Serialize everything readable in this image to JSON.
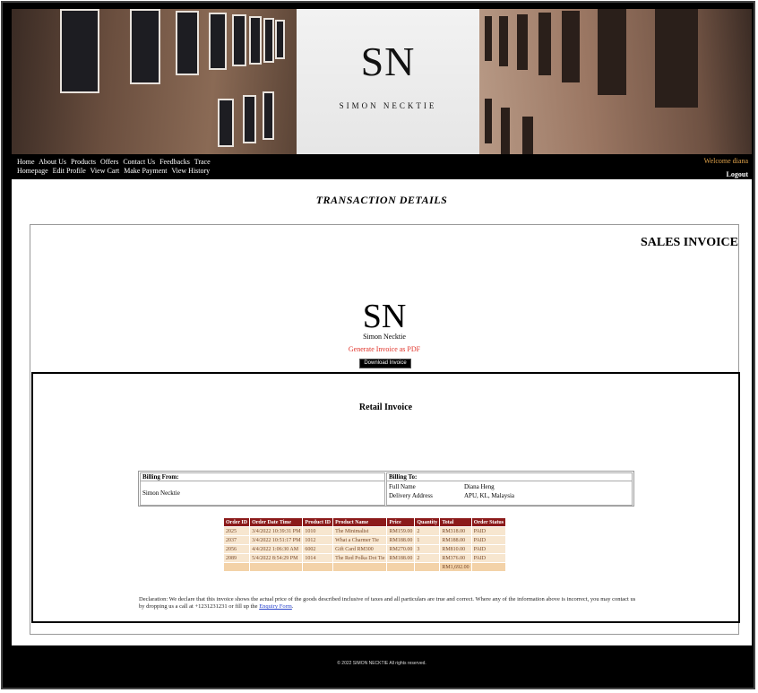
{
  "brand": {
    "logo": "SN",
    "name": "SIMON NECKTIE"
  },
  "nav": {
    "row1": [
      "Home",
      "About Us",
      "Products",
      "Offers",
      "Contact Us",
      "Feedbacks",
      "Trace"
    ],
    "row2": [
      "Homepage",
      "Edit Profile",
      "View Cart",
      "Make Payment",
      "View History"
    ],
    "welcome": "Welcome diana",
    "logout": "Logout"
  },
  "page_title": "TRANSACTION DETAILS",
  "invoice": {
    "heading": "SALES INVOICE",
    "logo": "SN",
    "company": "Simon Necktie",
    "generate_label": "Generate Invoice as PDF",
    "download_label": "Download Invoice",
    "retail_title": "Retail Invoice",
    "billing_from_label": "Billing From:",
    "billing_from_value": "Simon Necktie",
    "billing_to_label": "Billing To:",
    "full_name_label": "Full Name",
    "full_name_value": "Diana Heng",
    "address_label": "Delivery Address",
    "address_value": "APU, KL, Malaysia",
    "columns": [
      "Order ID",
      "Order Date Time",
      "Product ID",
      "Product Name",
      "Price",
      "Quantity",
      "Total",
      "Order Status"
    ],
    "rows": [
      [
        "2025",
        "3/4/2022 10:39:31 PM",
        "1010",
        "The Minimalist",
        "RM159.00",
        "2",
        "RM318.00",
        "PAID"
      ],
      [
        "2037",
        "3/4/2022 10:51:17 PM",
        "1012",
        "What a Charmer Tie",
        "RM188.00",
        "1",
        "RM188.00",
        "PAID"
      ],
      [
        "2056",
        "4/4/2022 1:06:30 AM",
        "6002",
        "Gift Card RM300",
        "RM270.00",
        "3",
        "RM810.00",
        "PAID"
      ],
      [
        "2089",
        "5/4/2022 8:54:29 PM",
        "1014",
        "The Red Polka Dot Tie",
        "RM188.00",
        "2",
        "RM376.00",
        "PAID"
      ]
    ],
    "grand_total": "RM1,692.00",
    "declaration": "Declaration: We declare that this invoice shows the actual price of the goods described inclusive of taxes and all particulars are true and correct. Where any of the information above is incorrect, you may contact us by dropping us a call at +1231231231 or fill up the",
    "enquiry_link": "Enquiry Form",
    "declaration_end": "."
  },
  "footer": "© 2022 SIMON NECKTIE All rights reserved."
}
